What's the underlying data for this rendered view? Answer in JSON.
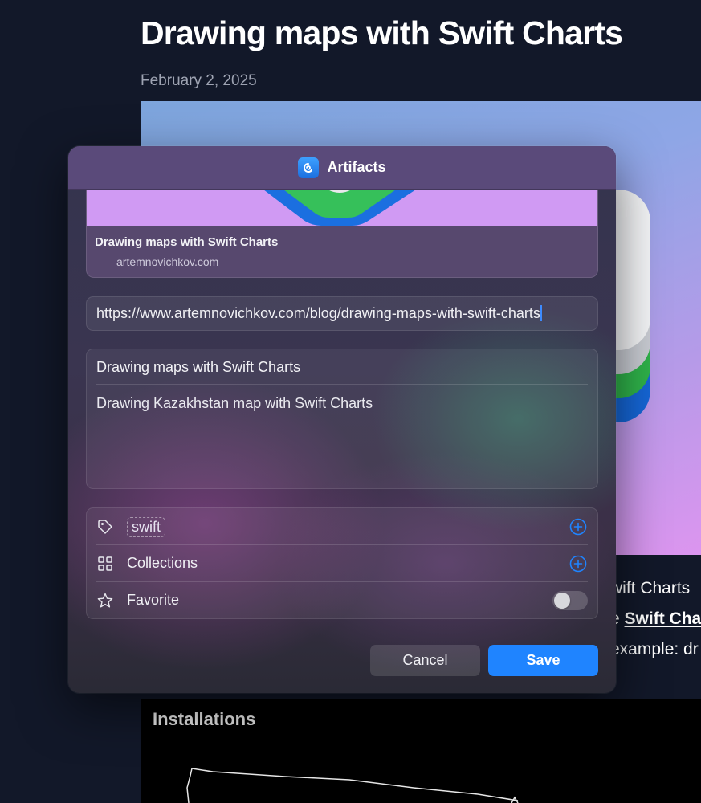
{
  "page": {
    "title": "Drawing maps with Swift Charts",
    "date": "February 2, 2025",
    "body_lines": [
      "wift Charts",
      "e",
      "Swift Cha",
      "example: dr"
    ],
    "map_card_title": "Installations"
  },
  "dialog": {
    "app_name": "Artifacts",
    "preview": {
      "title": "Drawing maps with Swift Charts",
      "domain": "artemnovichkov.com"
    },
    "url": "https://www.artemnovichkov.com/blog/drawing-maps-with-swift-charts",
    "title_field": "Drawing maps with Swift Charts",
    "description_field": "Drawing Kazakhstan map with Swift Charts",
    "options": {
      "tag": "swift",
      "collections_label": "Collections",
      "favorite_label": "Favorite",
      "favorite_on": false
    },
    "buttons": {
      "cancel": "Cancel",
      "save": "Save"
    }
  },
  "colors": {
    "accent": "#1f84ff",
    "page_background": "#121829",
    "dialog_header": "#5a4a7a"
  },
  "icons": [
    "app-icon",
    "tag-icon",
    "grid-icon",
    "star-icon",
    "plus-circle-icon"
  ]
}
